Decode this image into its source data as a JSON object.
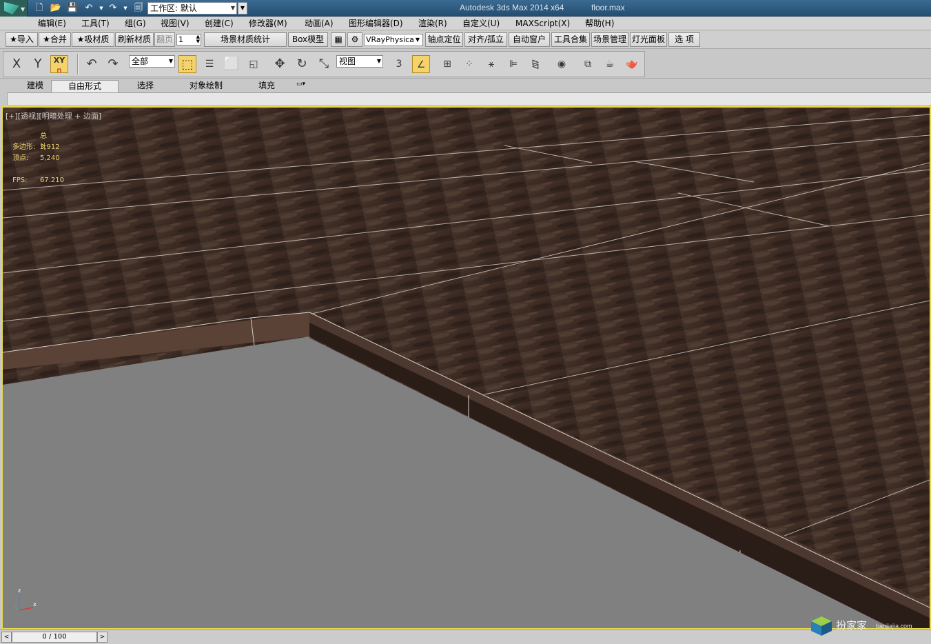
{
  "titlebar": {
    "app_title": "Autodesk 3ds Max  2014 x64",
    "file_name": "floor.max",
    "workspace_value": "工作区: 默认"
  },
  "menu": [
    "编辑(E)",
    "工具(T)",
    "组(G)",
    "视图(V)",
    "创建(C)",
    "修改器(M)",
    "动画(A)",
    "图形编辑器(D)",
    "渲染(R)",
    "自定义(U)",
    "MAXScript(X)",
    "帮助(H)"
  ],
  "custom_toolbar": {
    "import": "★导入",
    "merge": "★合并",
    "pick_material": "★吸材质",
    "refresh_material": "刷新材质",
    "page_label": "翻页",
    "page_value": "1",
    "scene_material_stats": "场景材质统计",
    "box_model": "Box模型",
    "renderer": "VRayPhysicalC",
    "pivot_locate": "轴点定位",
    "align_isolate": "对齐/孤立",
    "auto_window": "自动窗户",
    "toolset": "工具合集",
    "scene_manage": "场景管理",
    "light_panel": "灯光面板",
    "options": "选 项"
  },
  "main_toolbar": {
    "axis_x": "X",
    "axis_y": "Y",
    "axis_xy": "XY",
    "selection_filter": "全部",
    "reference_coord": "视图",
    "snap_label": "3"
  },
  "ribbon": {
    "tabs": [
      "建模",
      "自由形式",
      "选择",
      "对象绘制",
      "填充"
    ],
    "active_tab": "自由形式"
  },
  "viewport": {
    "label": "[+][透视][明暗处理 + 边面]",
    "stats_header": "总计",
    "polys_label": "多边形:",
    "polys_value": "3,912",
    "verts_label": "顶点:",
    "verts_value": "5,240",
    "fps_label": "FPS:",
    "fps_value": "67.210",
    "gizmo_z": "z",
    "gizmo_x": "x"
  },
  "trackbar": {
    "frame_display": "0 / 100",
    "prev": "<",
    "next": ">"
  },
  "watermark": {
    "brand": "扮家家",
    "url": "banjiajia.com"
  },
  "colors": {
    "viewport_border": "#e8d84a",
    "active_tool": "#f5d36b",
    "stats_text": "#e8d070",
    "ground_gray": "#808080"
  }
}
